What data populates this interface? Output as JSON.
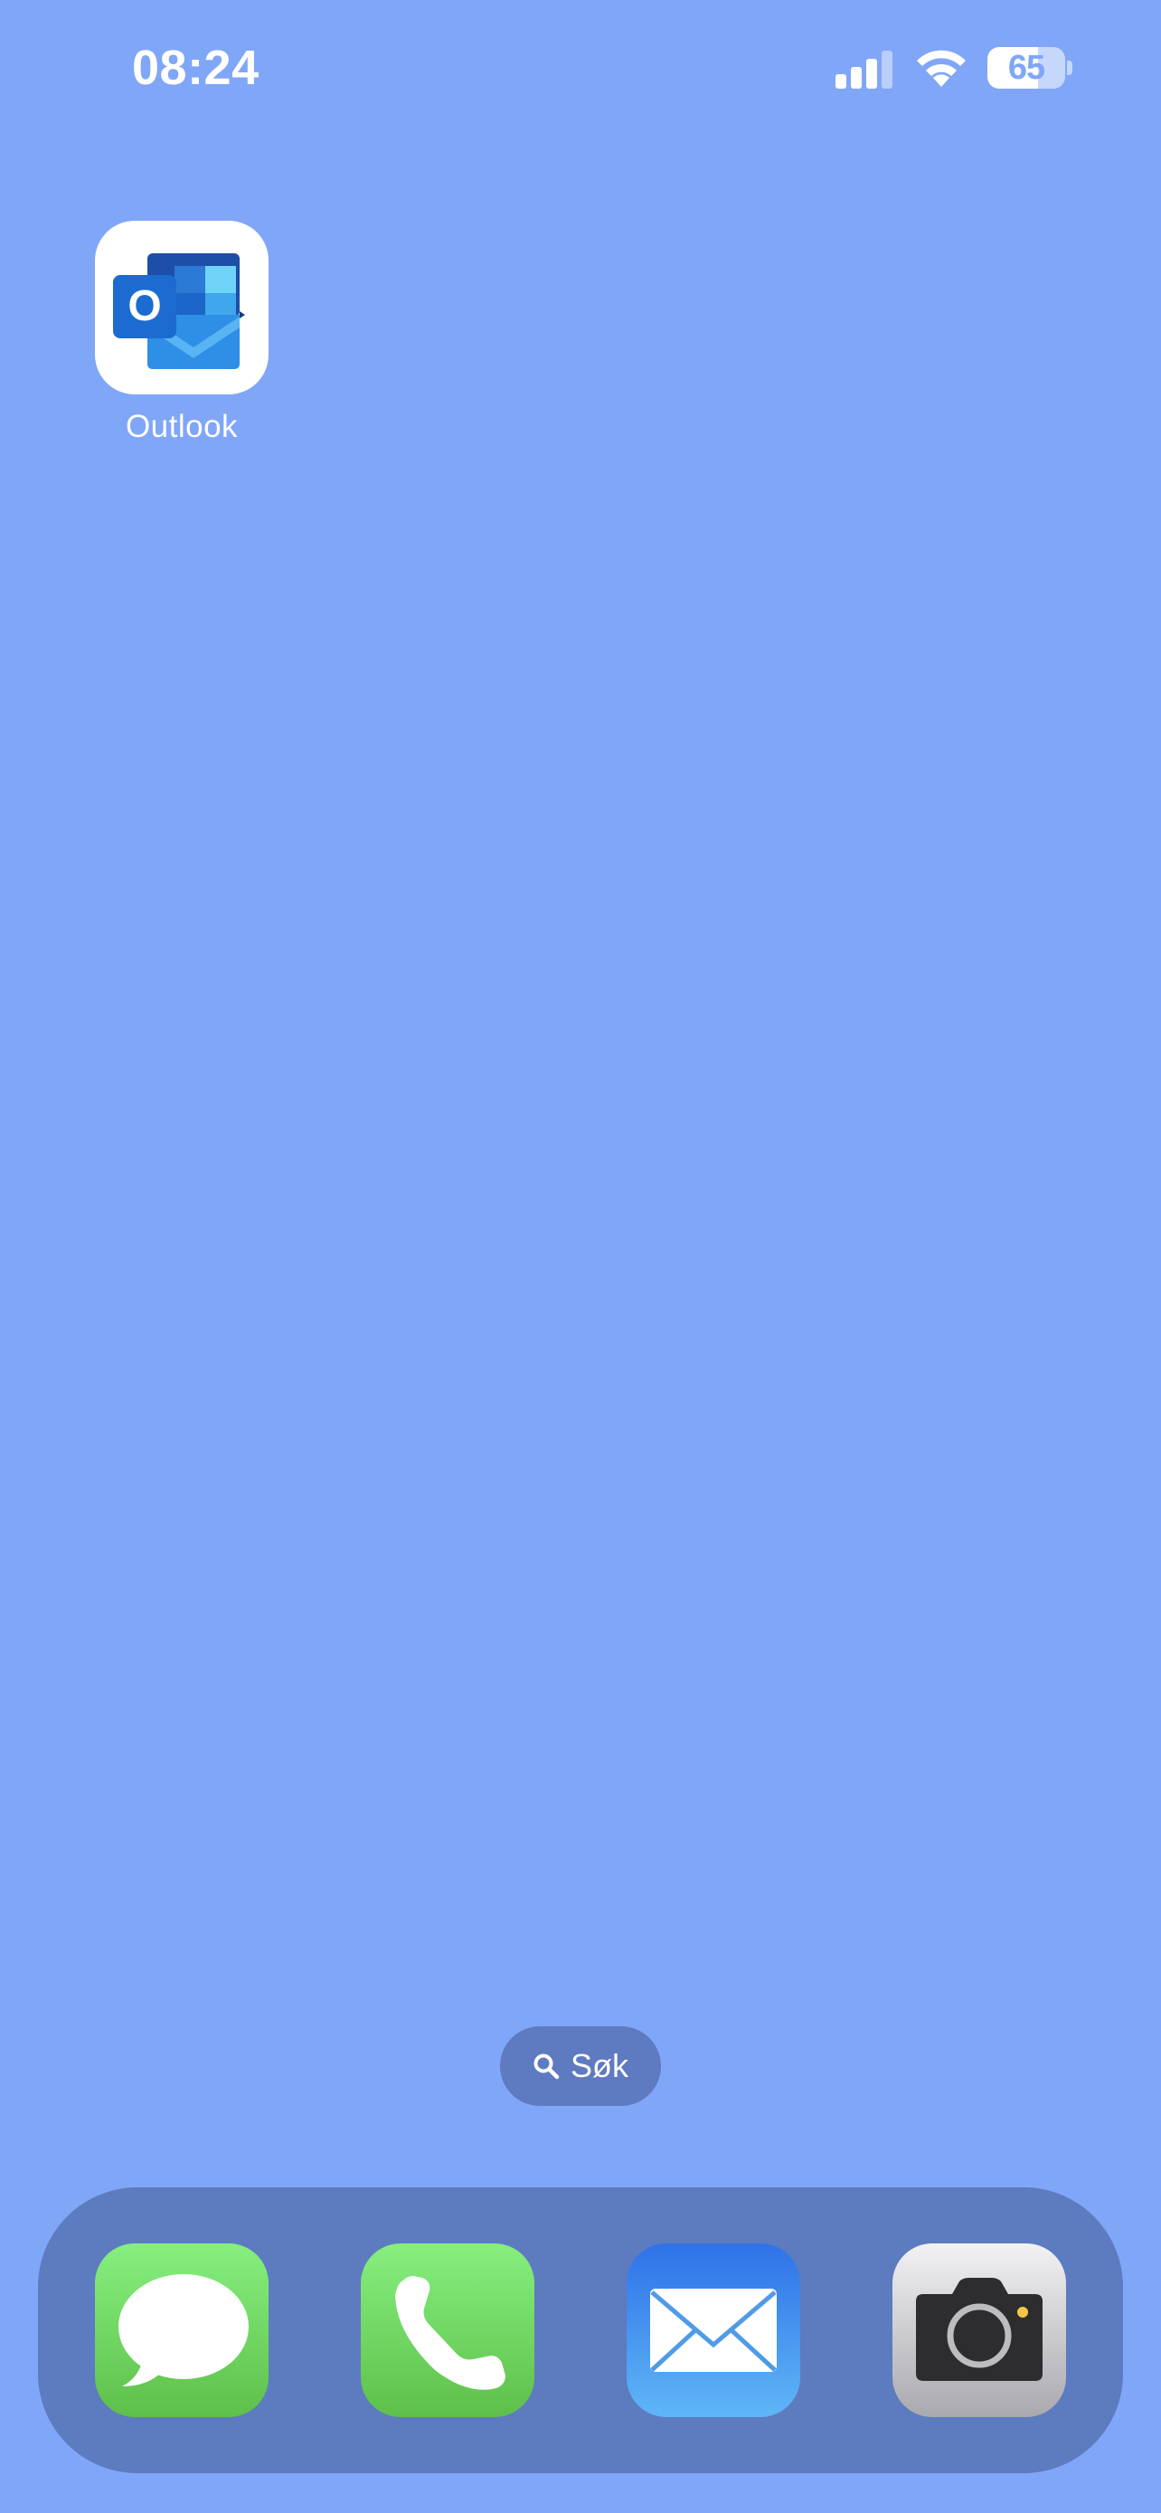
{
  "status_bar": {
    "time": "08:24",
    "battery_level": "65",
    "battery_fraction": 0.65
  },
  "home_screen": {
    "apps": [
      {
        "label": "Outlook",
        "icon": "outlook-icon"
      }
    ]
  },
  "search": {
    "label": "Søk",
    "icon": "search-icon"
  },
  "dock": {
    "apps": [
      {
        "name": "messages",
        "icon": "messages-icon"
      },
      {
        "name": "phone",
        "icon": "phone-icon"
      },
      {
        "name": "mail",
        "icon": "mail-icon"
      },
      {
        "name": "camera",
        "icon": "camera-icon"
      }
    ]
  },
  "colors": {
    "wallpaper": "#80a6f8",
    "dock": "#5d7bbf",
    "search_pill": "#5e7ac0",
    "ios_green": "#5ec04a",
    "mail_blue": "#2f72e8",
    "outlook_blue": "#1b6bd0"
  }
}
